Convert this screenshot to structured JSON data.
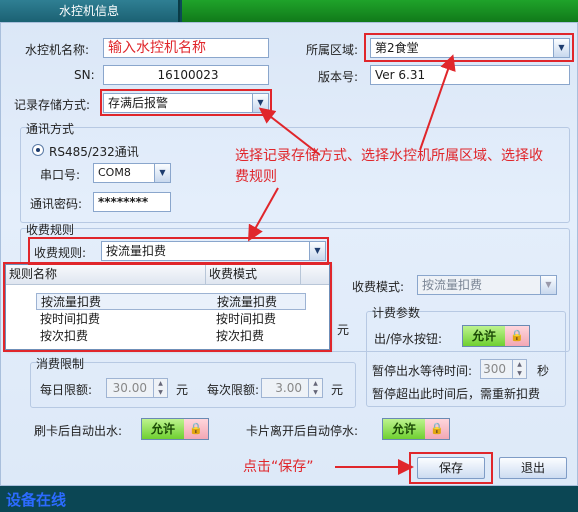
{
  "window": {
    "title": "水控机信息"
  },
  "form": {
    "name_label": "水控机名称:",
    "name_value": "输入水控机名称",
    "sn_label": "SN:",
    "sn_value": "16100023",
    "area_label": "所属区域:",
    "area_value": "第2食堂",
    "version_label": "版本号:",
    "version_value": "Ver 6.31",
    "storage_label": "记录存储方式:",
    "storage_value": "存满后报警"
  },
  "comm": {
    "group_title": "通讯方式",
    "radio_label": "RS485/232通讯",
    "port_label": "串口号:",
    "port_value": "COM8",
    "password_label": "通讯密码:",
    "password_value": "********"
  },
  "annotation1": "选择记录存储方式、选择水控机所属区域、选择收费规则",
  "billing": {
    "group_title": "收费规则",
    "rule_label": "收费规则:",
    "rule_value": "按流量扣费",
    "mode_label": "收费模式:",
    "mode_value": "按流量扣费",
    "list_headers": [
      "规则名称",
      "收费模式"
    ],
    "list_rows": [
      [
        "按流量扣费",
        "按流量扣费"
      ],
      [
        "按时间扣费",
        "按时间扣费"
      ],
      [
        "按次扣费",
        "按次扣费"
      ]
    ],
    "unit_yuan": "元"
  },
  "limit": {
    "group_title": "消费限制",
    "daily_label": "每日限额:",
    "daily_value": "30.00",
    "per_label": "每次限额:",
    "per_value": "3.00",
    "unit": "元"
  },
  "timing": {
    "group_title": "计费参数",
    "pause_btn_label": "出/停水按钮:",
    "wait_label": "暂停出水等待时间:",
    "wait_value": "300",
    "wait_unit": "秒",
    "note": "暂停超出此时间后，需重新扣费"
  },
  "auto": {
    "swipe_label": "刷卡后自动出水:",
    "leave_label": "卡片离开后自动停水:"
  },
  "toggle_label": "允许",
  "annotation2": "点击“保存”",
  "buttons": {
    "save": "保存",
    "exit": "退出"
  },
  "status": "设备在线",
  "colors": {
    "annotation": "#e0262b",
    "status_text": "#2c6bff",
    "toggle_on": "#6fd031"
  }
}
